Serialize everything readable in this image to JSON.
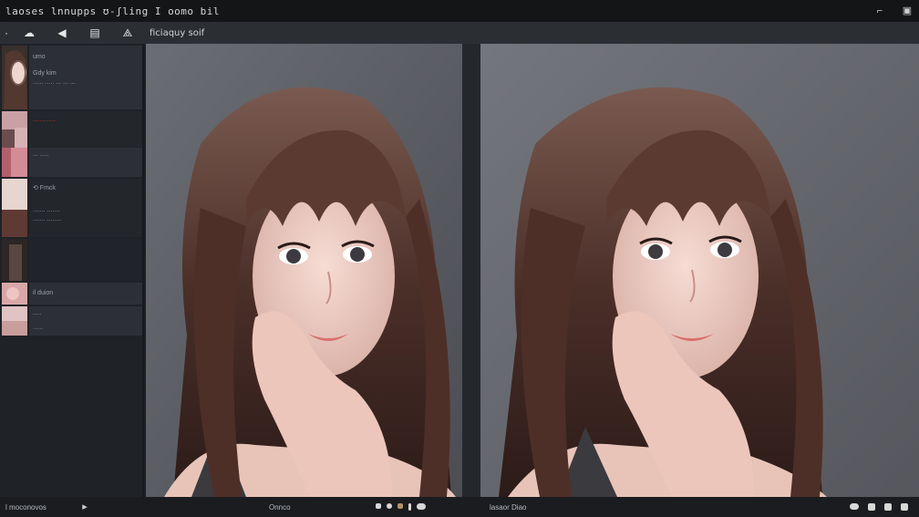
{
  "window": {
    "title": "laoses lnnupps ʊ-ʃling I oomo bil",
    "buttons": [
      "minimize-icon",
      "close-icon"
    ]
  },
  "toolbar": {
    "tools": [
      {
        "name": "back-icon",
        "glyph": "◂"
      },
      {
        "name": "cloud-icon",
        "glyph": "☁"
      },
      {
        "name": "pointer-icon",
        "glyph": "◀"
      },
      {
        "name": "document-icon",
        "glyph": "▤"
      },
      {
        "name": "triangle-icon",
        "glyph": "▲"
      }
    ],
    "label": "ficiaquy soif"
  },
  "sidebar": {
    "items": [
      {
        "line1": "umo",
        "line2": "Gdy kim",
        "line3": "...... ..... ... ... ..."
      },
      {
        "line1": "..........",
        "line2": ""
      },
      {
        "line1": "... .....",
        "line2": ""
      },
      {
        "line1": "⟲ Fmck",
        "line2": "....... .......",
        "line3": "....... ........"
      },
      {
        "line1": "",
        "line2": ""
      },
      {
        "line1": "il duion",
        "line2": "....."
      },
      {
        "line1": "......",
        "line2": ""
      }
    ]
  },
  "canvas": {
    "left_caption": "Onnco",
    "right_caption": "lasaor Diao"
  },
  "status": {
    "left_text": "l moconovos"
  },
  "colors": {
    "background": "#1c1e21",
    "titlebar": "#141517",
    "toolbar": "#2b2e33",
    "canvas_left": "#5d5f66",
    "canvas_right": "#6a6c73",
    "hair": "#4a2e28",
    "skin": "#e9c8c0"
  }
}
